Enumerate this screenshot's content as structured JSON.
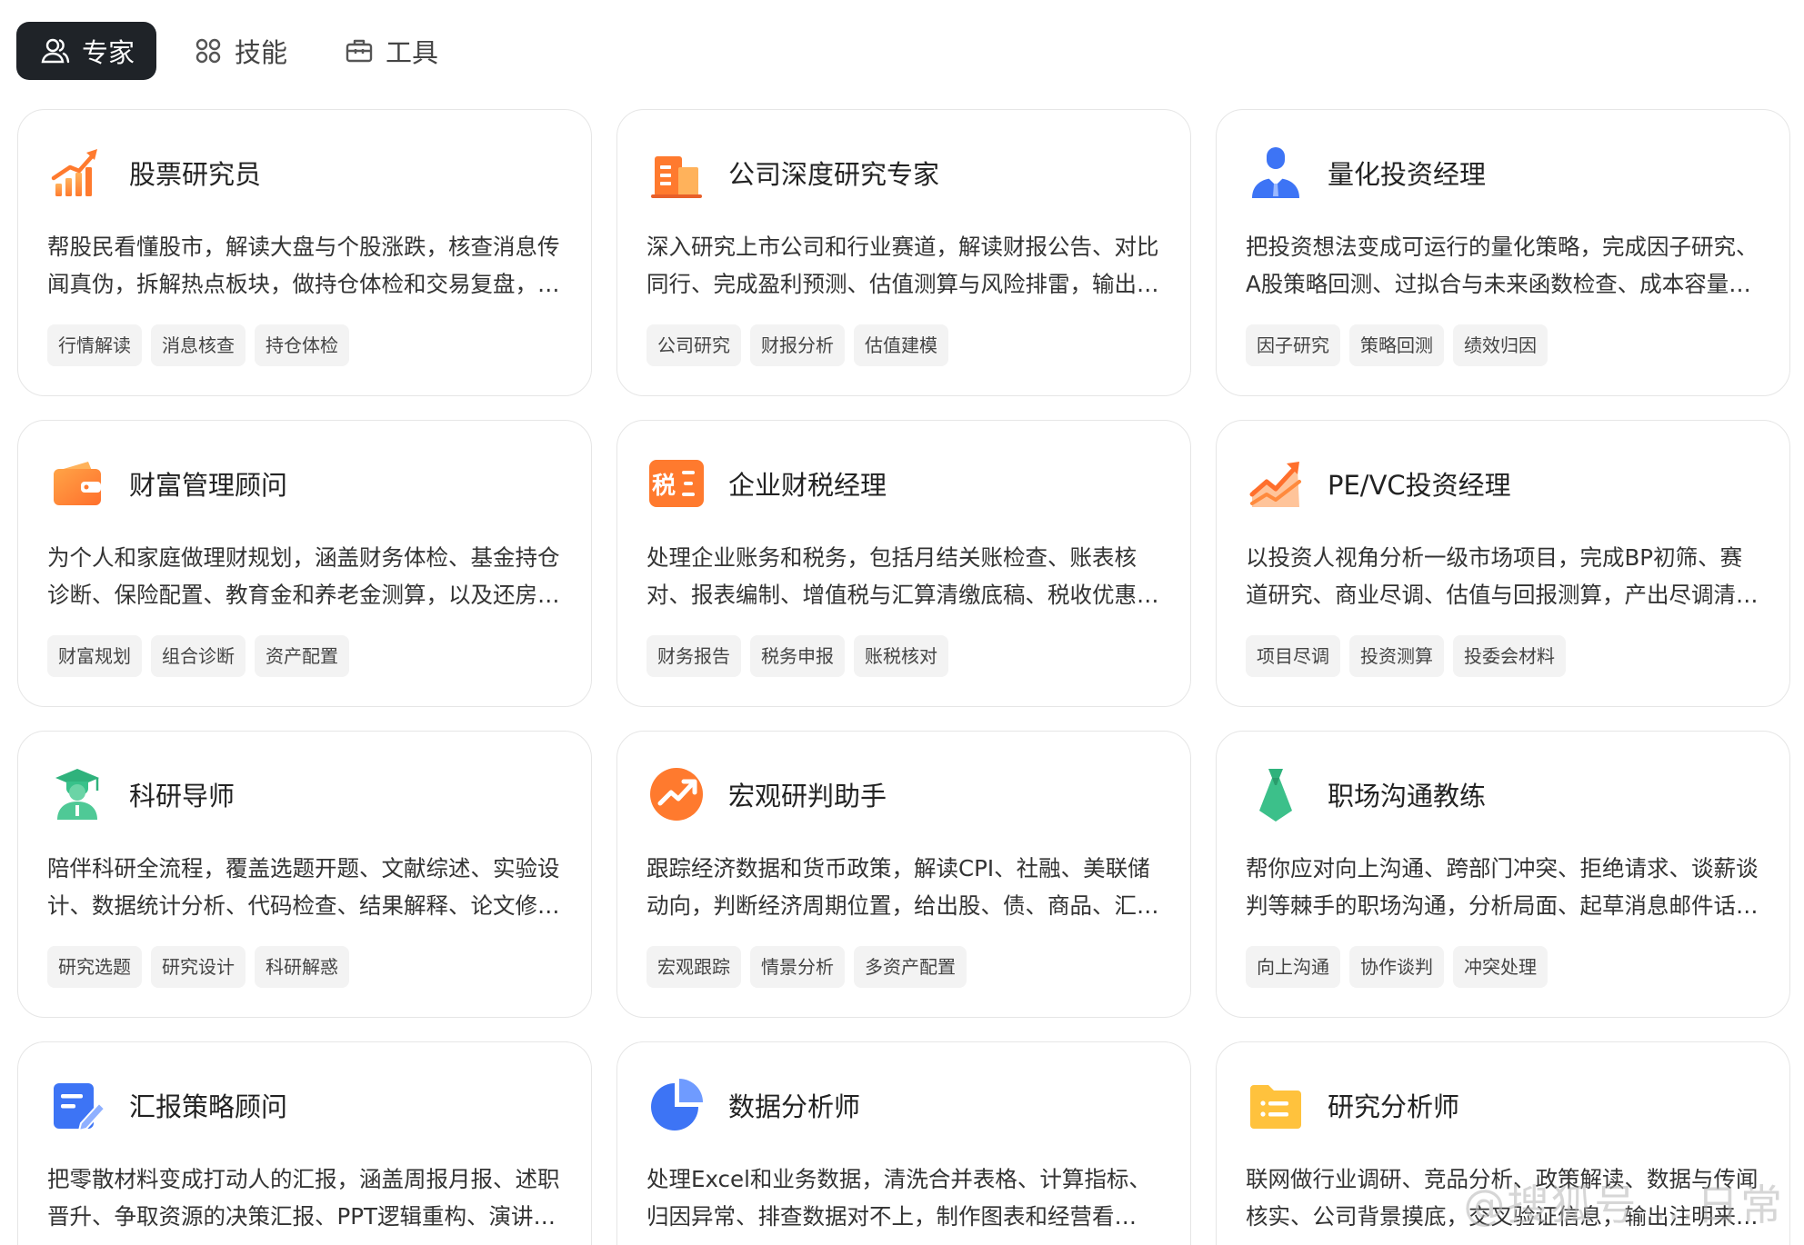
{
  "tabs": [
    {
      "label": "专家",
      "icon": "user-group-icon",
      "active": true
    },
    {
      "label": "技能",
      "icon": "grid-dots-icon",
      "active": false
    },
    {
      "label": "工具",
      "icon": "toolbox-icon",
      "active": false
    }
  ],
  "cards": [
    {
      "title": "股票研究员",
      "icon": "rising-bar-chart-icon",
      "desc": "帮股民看懂股市，解读大盘与个股涨跌，核查消息传闻真伪，拆解热点板块，做持仓体检和交易复盘，…",
      "tags": [
        "行情解读",
        "消息核查",
        "持仓体检"
      ]
    },
    {
      "title": "公司深度研究专家",
      "icon": "building-icon",
      "desc": "深入研究上市公司和行业赛道，解读财报公告、对比同行、完成盈利预测、估值测算与风险排雷，输出…",
      "tags": [
        "公司研究",
        "财报分析",
        "估值建模"
      ]
    },
    {
      "title": "量化投资经理",
      "icon": "businessman-icon",
      "desc": "把投资想法变成可运行的量化策略，完成因子研究、A股策略回测、过拟合与未来函数检查、成本容量测…",
      "tags": [
        "因子研究",
        "策略回测",
        "绩效归因"
      ]
    },
    {
      "title": "财富管理顾问",
      "icon": "wallet-icon",
      "desc": "为个人和家庭做理财规划，涵盖财务体检、基金持仓诊断、保险配置、教育金和养老金测算，以及还房…",
      "tags": [
        "财富规划",
        "组合诊断",
        "资产配置"
      ]
    },
    {
      "title": "企业财税经理",
      "icon": "tax-icon",
      "desc": "处理企业账务和税务，包括月结关账检查、账表核对、报表编制、增值税与汇算清缴底稿、税收优惠…",
      "tags": [
        "财务报告",
        "税务申报",
        "账税核对"
      ]
    },
    {
      "title": "PE/VC投资经理",
      "icon": "trend-chart-icon",
      "desc": "以投资人视角分析一级市场项目，完成BP初筛、赛道研究、商业尽调、估值与回报测算，产出尽调清单…",
      "tags": [
        "项目尽调",
        "投资测算",
        "投委会材料"
      ]
    },
    {
      "title": "科研导师",
      "icon": "graduate-icon",
      "desc": "陪伴科研全流程，覆盖选题开题、文献综述、实验设计、数据统计分析、代码检查、结果解释、论文修…",
      "tags": [
        "研究选题",
        "研究设计",
        "科研解惑"
      ]
    },
    {
      "title": "宏观研判助手",
      "icon": "trend-circle-icon",
      "desc": "跟踪经济数据和货币政策，解读CPI、社融、美联储动向，判断经济周期位置，给出股、债、商品、汇率…",
      "tags": [
        "宏观跟踪",
        "情景分析",
        "多资产配置"
      ]
    },
    {
      "title": "职场沟通教练",
      "icon": "necktie-icon",
      "desc": "帮你应对向上沟通、跨部门冲突、拒绝请求、谈薪谈判等棘手的职场沟通，分析局面、起草消息邮件话…",
      "tags": [
        "向上沟通",
        "协作谈判",
        "冲突处理"
      ]
    },
    {
      "title": "汇报策略顾问",
      "icon": "edit-document-icon",
      "desc": "把零散材料变成打动人的汇报，涵盖周报月报、述职晋升、争取资源的决策汇报、PPT逻辑重构、演讲稿…",
      "tags": []
    },
    {
      "title": "数据分析师",
      "icon": "pie-chart-icon",
      "desc": "处理Excel和业务数据，清洗合并表格、计算指标、归因异常、排查数据对不上，制作图表和经营看板，…",
      "tags": []
    },
    {
      "title": "研究分析师",
      "icon": "folder-list-icon",
      "desc": "联网做行业调研、竞品分析、政策解读、数据与传闻核实、公司背景摸底，交叉验证信息，输出注明来…",
      "tags": []
    }
  ],
  "colors": {
    "active_tab_bg": "#1f2328",
    "tag_bg": "#f3f3f3",
    "card_border": "#e6e6e6"
  },
  "watermark": "@搜狐号 …日常"
}
